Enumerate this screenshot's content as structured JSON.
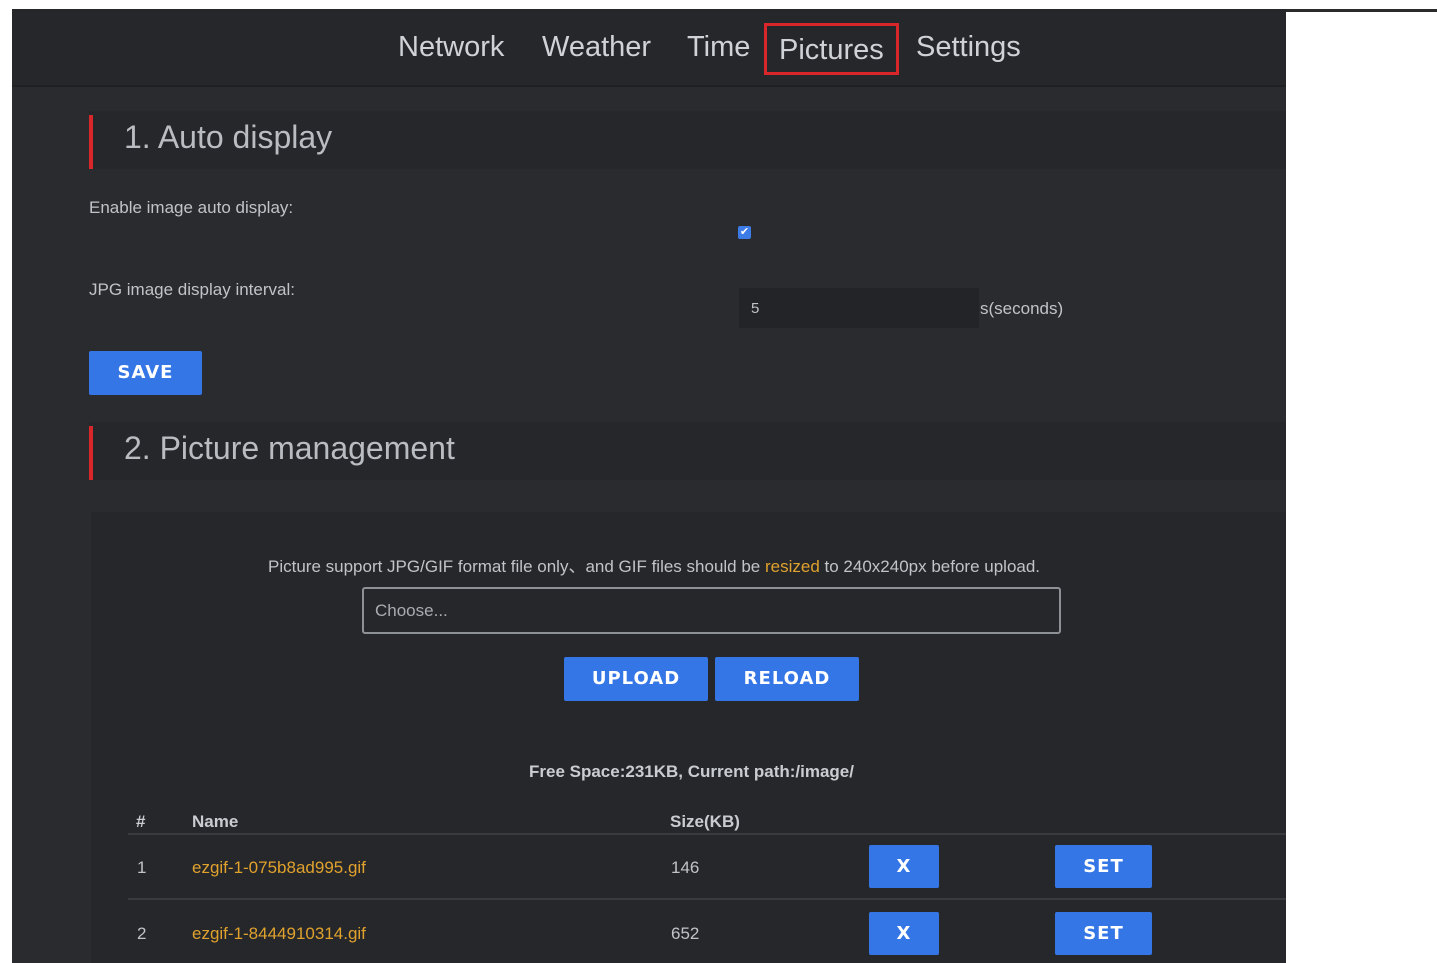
{
  "nav": {
    "items": [
      {
        "label": "Network"
      },
      {
        "label": "Weather"
      },
      {
        "label": "Time"
      },
      {
        "label": "Pictures",
        "active": true
      },
      {
        "label": "Settings"
      }
    ]
  },
  "auto_display": {
    "title": "1. Auto display",
    "enable_label": "Enable image auto display:",
    "enable_checked": true,
    "check_glyph": "✔",
    "interval_label": "JPG image display interval:",
    "interval_value": "5",
    "interval_unit": "s(seconds)",
    "save_label": "SAVE"
  },
  "picture_management": {
    "title": "2. Picture management",
    "hint_before": "Picture support JPG/GIF format file only、and GIF files should be ",
    "hint_highlight": "resized",
    "hint_after": " to 240x240px before upload.",
    "file_placeholder": "Choose...",
    "upload_label": "UPLOAD",
    "reload_label": "RELOAD",
    "free_space": "Free Space:231KB, Current path:/image/",
    "table": {
      "headers": {
        "index": "#",
        "name": "Name",
        "size": "Size(KB)"
      },
      "rows": [
        {
          "index": "1",
          "name": "ezgif-1-075b8ad995.gif",
          "size": "146",
          "delete_label": "X",
          "set_label": "SET"
        },
        {
          "index": "2",
          "name": "ezgif-1-8444910314.gif",
          "size": "652",
          "delete_label": "X",
          "set_label": "SET"
        }
      ]
    }
  },
  "colors": {
    "accent": "#3576e6",
    "active_border": "#d9262b",
    "highlight": "#e0a22d",
    "background": "#2a2b2e"
  }
}
